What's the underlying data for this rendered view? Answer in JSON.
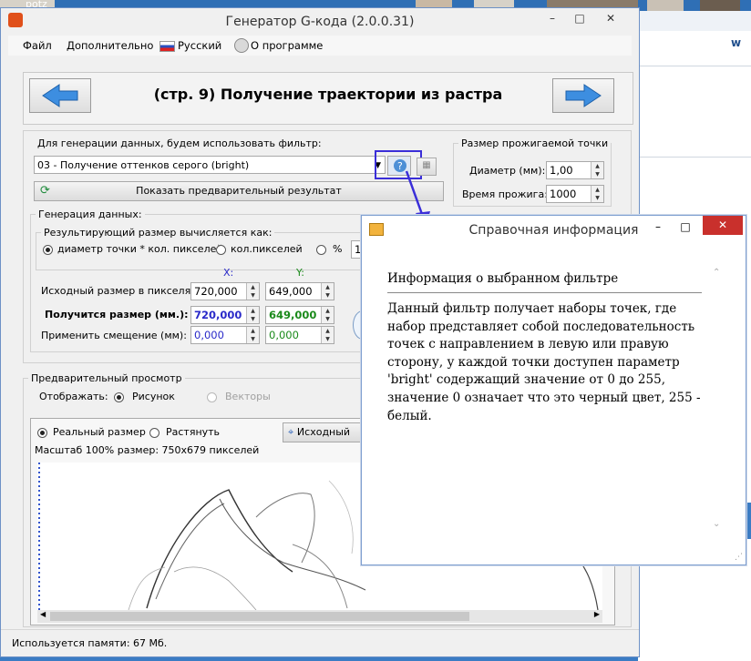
{
  "desktop": {
    "taskbar_fragment": "potz",
    "right_edge_letter": "w"
  },
  "window": {
    "title": "Генератор G-кода (2.0.0.31)",
    "controls": {
      "minimize": "–",
      "maximize": "□",
      "close": "✕"
    }
  },
  "menu": {
    "file": "Файл",
    "extra": "Дополнительно",
    "language": "Русский",
    "about": "О программе"
  },
  "page": {
    "title": "(стр. 9) Получение траектории из растра",
    "back_icon": "arrow-left-icon",
    "forward_icon": "arrow-right-icon"
  },
  "filter": {
    "label": "Для генерации данных, будем использовать фильтр:",
    "selected": "03 - Получение оттенков серого (bright)",
    "preview_button": "Показать предварительный результат"
  },
  "burn_point": {
    "group_label": "Размер прожигаемой точки",
    "diameter_label": "Диаметр (мм):",
    "diameter_value": "1,00",
    "burn_time_label": "Время прожига:",
    "burn_time_value": "1000"
  },
  "generation": {
    "group_label": "Генерация данных:",
    "result_size_label": "Результирующий размер вычисляется как:",
    "radio_point_diameter": "диаметр точки * кол. пикселей",
    "radio_pixels": "кол.пикселей",
    "radio_percent": "%",
    "percent_value": "10",
    "x_header": "X:",
    "y_header": "Y:",
    "source_size_label": "Исходный размер в пикселях:",
    "source_x": "720,000",
    "source_y": "649,000",
    "result_size_label2": "Получится размер (мм.):",
    "result_x": "720,000",
    "result_y": "649,000",
    "offset_label": "Применить смещение (мм):",
    "offset_x": "0,000",
    "offset_y": "0,000"
  },
  "preview": {
    "group_label": "Предварительный просмотр",
    "display_label": "Отображать:",
    "radio_picture": "Рисунок",
    "radio_vectors": "Векторы",
    "radio_real_size": "Реальный размер",
    "radio_stretch": "Растянуть",
    "source_button": "Исходный",
    "scale_text": "Масштаб 100% размер: 750x679 пикселей"
  },
  "status": {
    "memory": "Используется памяти:  67  Мб."
  },
  "help_dialog": {
    "title": "Справочная информация",
    "heading": "Информация о выбранном фильтре",
    "body": "Данный фильтр получает наборы точек, где набор представляет собой последовательность точек с направлением в левую или правую сторону, у каждой точки доступен параметр 'bright' содержащий значение от 0 до 255, значение 0 означает что это черный цвет, 255 - белый.",
    "controls": {
      "minimize": "–",
      "maximize": "□",
      "close": "✕"
    }
  },
  "colors": {
    "accent_blue": "#2a2ac9",
    "green_value": "#1a8a1a",
    "close_red": "#c9302c"
  }
}
